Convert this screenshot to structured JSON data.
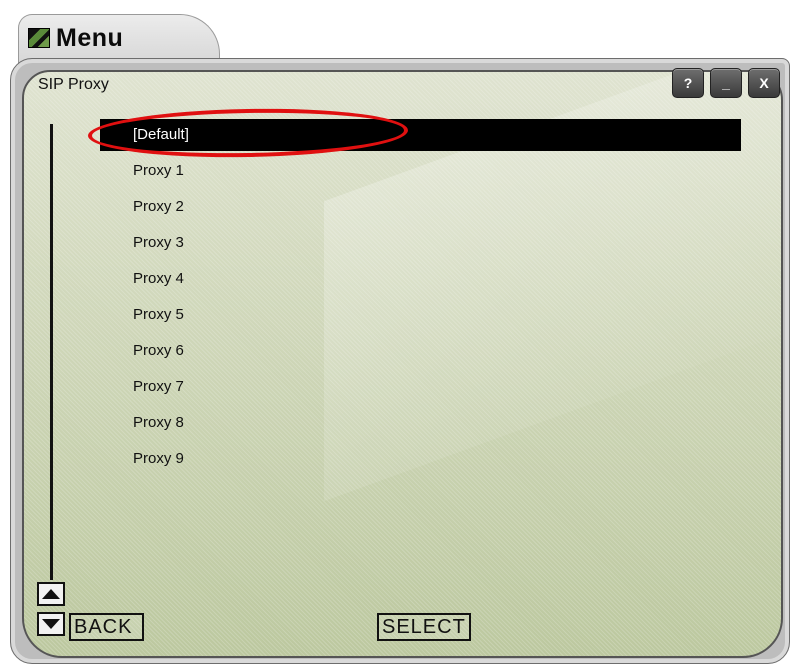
{
  "window": {
    "menu_title": "Menu",
    "screen_title": "SIP Proxy",
    "controls": {
      "help": "?",
      "minimize": "_",
      "close": "X"
    }
  },
  "list": {
    "items": [
      "[Default]",
      "Proxy 1",
      "Proxy 2",
      "Proxy 3",
      "Proxy 4",
      "Proxy 5",
      "Proxy 6",
      "Proxy 7",
      "Proxy 8",
      "Proxy 9"
    ],
    "selected_index": 0
  },
  "softkeys": {
    "left": "BACK",
    "center": "SELECT"
  },
  "icons": {
    "menu": "menu-app-icon",
    "scroll_up": "arrow-up-icon",
    "scroll_down": "arrow-down-icon"
  },
  "colors": {
    "selection_bg": "#000000",
    "selection_fg": "#ffffff",
    "screen_bg": "#d2d9bd",
    "annotation": "#e01010"
  }
}
